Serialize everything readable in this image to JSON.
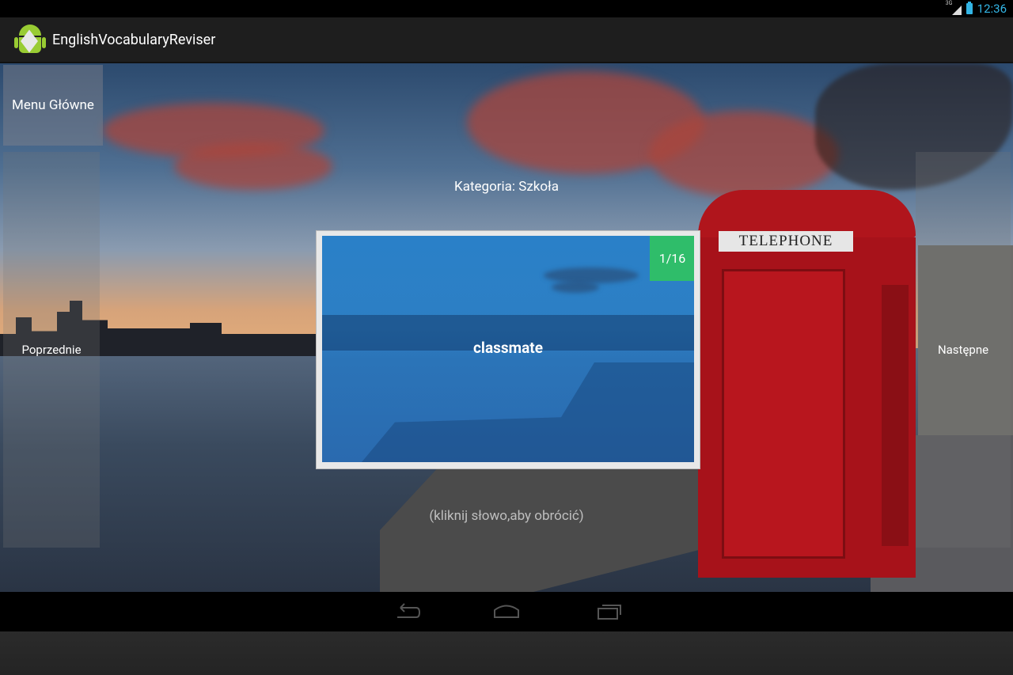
{
  "status_bar": {
    "network": "3G",
    "time": "12:36"
  },
  "action_bar": {
    "title": "EnglishVocabularyReviser",
    "icon": "android-app-icon"
  },
  "buttons": {
    "menu": "Menu Główne",
    "previous": "Poprzednie",
    "next": "Następne"
  },
  "category_label": "Kategoria: Szkoła",
  "card": {
    "word": "classmate",
    "counter": "1/16"
  },
  "hint": "(kliknij słowo,aby obrócić)",
  "phonebox_sign": "TELEPHONE",
  "nav": {
    "back": "back-icon",
    "home": "home-icon",
    "recent": "recent-apps-icon"
  },
  "colors": {
    "counter_bg": "#2fbd6a",
    "card_bg": "#2d7fc4",
    "status_accent": "#33b5e5"
  }
}
